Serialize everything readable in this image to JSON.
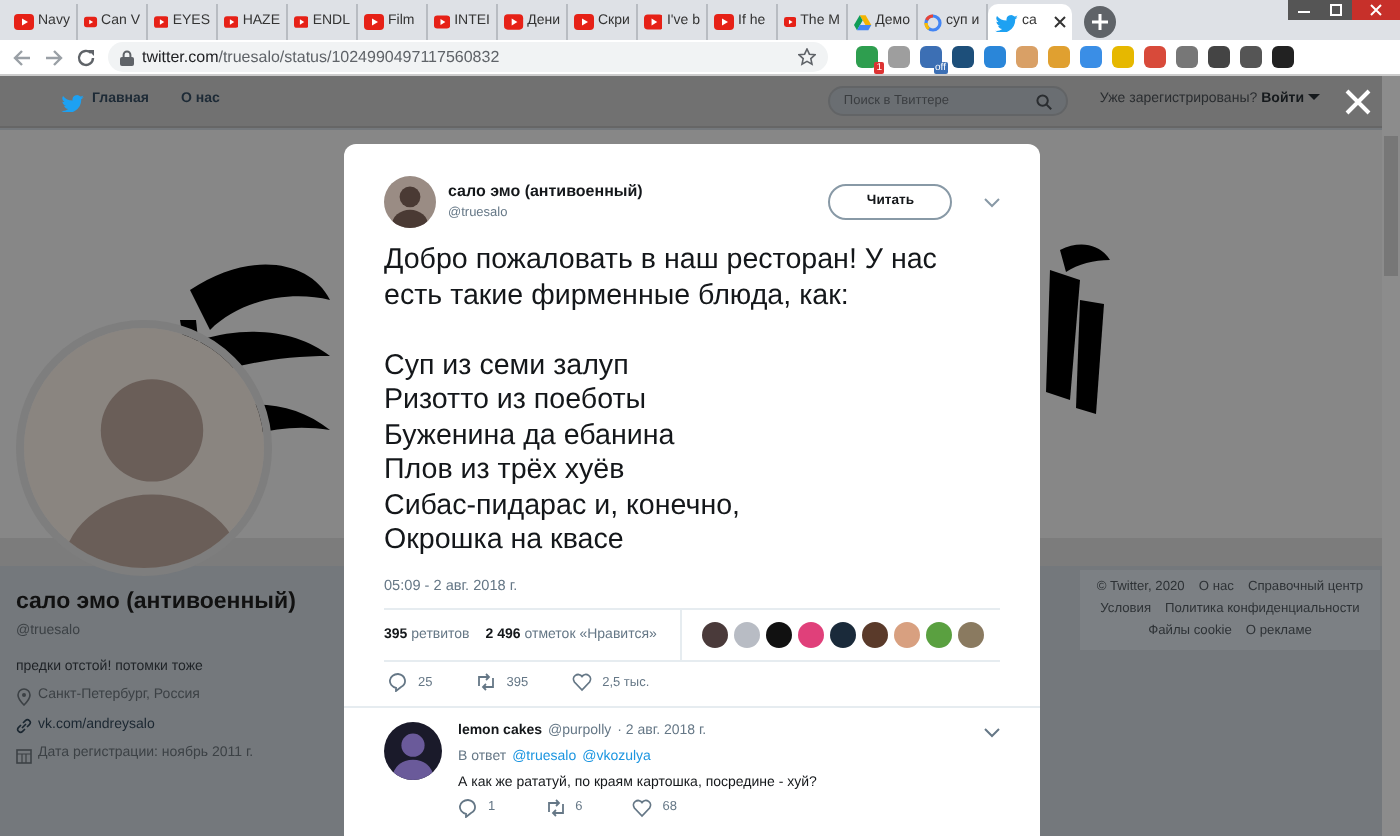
{
  "browser": {
    "tabs": [
      {
        "title": "Navy",
        "kind": "youtube",
        "selected": false
      },
      {
        "title": "Can V",
        "kind": "youtube",
        "selected": false
      },
      {
        "title": "EYES",
        "kind": "youtube",
        "selected": false
      },
      {
        "title": "HAZE",
        "kind": "youtube",
        "selected": false
      },
      {
        "title": "ENDL",
        "kind": "youtube",
        "selected": false
      },
      {
        "title": "Film",
        "kind": "youtube",
        "selected": false
      },
      {
        "title": "INTEI",
        "kind": "youtube",
        "selected": false
      },
      {
        "title": "Дени",
        "kind": "youtube",
        "selected": false
      },
      {
        "title": "Скри",
        "kind": "youtube",
        "selected": false
      },
      {
        "title": "I've b",
        "kind": "youtube",
        "selected": false
      },
      {
        "title": "If he",
        "kind": "youtube",
        "selected": false
      },
      {
        "title": "The M",
        "kind": "youtube",
        "selected": false
      },
      {
        "title": "Демо",
        "kind": "drive",
        "selected": false
      },
      {
        "title": "суп и",
        "kind": "google",
        "selected": false
      },
      {
        "title": "ca",
        "kind": "twitter",
        "selected": true
      }
    ],
    "url_host": "twitter.com",
    "url_path": "/truesalo/status/1024990497117560832",
    "extensions": [
      {
        "color": "#2e9e4f",
        "badge": "1"
      },
      {
        "color": "#9e9e9e"
      },
      {
        "color": "#3c6fb4",
        "badge": "off"
      },
      {
        "color": "#1d4f7a"
      },
      {
        "color": "#2a86d9"
      },
      {
        "color": "#d9a066"
      },
      {
        "color": "#e0a030"
      },
      {
        "color": "#3a8ee6"
      },
      {
        "color": "#e6b800"
      },
      {
        "color": "#d84a3a"
      },
      {
        "color": "#777777"
      },
      {
        "color": "#444444"
      },
      {
        "color": "#555555"
      },
      {
        "color": "#222222"
      }
    ]
  },
  "twitter_nav": {
    "items": [
      "Главная",
      "О нас"
    ],
    "search": {
      "placeholder": "Поиск в Твиттере"
    },
    "login_prompt": "Уже зарегистрированы?",
    "login": "Войти"
  },
  "profile": {
    "name": "сало эмо (антивоенный)",
    "handle": "@truesalo",
    "bio": "предки отстой! потомки тоже",
    "location": "Санкт-Петербург, Россия",
    "link": "vk.com/andreysalo",
    "joined": "Дата регистрации: ноябрь 2011 г."
  },
  "footer": [
    "© Twitter, 2020",
    "О нас",
    "Справочный центр",
    "Условия",
    "Политика конфиденциальности",
    "Файлы cookie",
    "О рекламе"
  ],
  "tweet": {
    "name": "сало эмо (антивоенный)",
    "handle": "@truesalo",
    "follow": "Читать",
    "intro": "Добро пожаловать в наш ресторан! У нас есть такие фирменные блюда, как:",
    "lines": [
      "Суп из семи залуп",
      "Ризотто из поеботы",
      "Буженина да ебанина",
      "Плов из трёх хуёв",
      "Сибас-пидарас и, конечно,",
      "Окрошка на квасе"
    ],
    "time": "05:09 - 2 авг. 2018 г.",
    "retweets": "395",
    "retweets_label": "ретвитов",
    "likes": "2 496",
    "likes_label": "отметок «Нравится»",
    "likers": [
      {
        "color": "#4a3a3a"
      },
      {
        "color": "#b8bcc4"
      },
      {
        "color": "#111111"
      },
      {
        "color": "#e0407a"
      },
      {
        "color": "#1a2a3a"
      },
      {
        "color": "#5a3a2a"
      },
      {
        "color": "#d8a080"
      },
      {
        "color": "#5aa040"
      },
      {
        "color": "#8a7a60"
      }
    ],
    "replies": "25",
    "retweet_count": "395",
    "like_count": "2,5 тыс."
  },
  "reply": {
    "name": "lemon cakes",
    "handle": "@purpolly",
    "date": "· 2 авг. 2018 г.",
    "in_reply": "В ответ",
    "mentions": [
      "@truesalo",
      "@vkozulya"
    ],
    "text": "А как же рататуй, по краям картошка, посредине - хуй?",
    "replies": "1",
    "retweets": "6",
    "likes": "68"
  }
}
